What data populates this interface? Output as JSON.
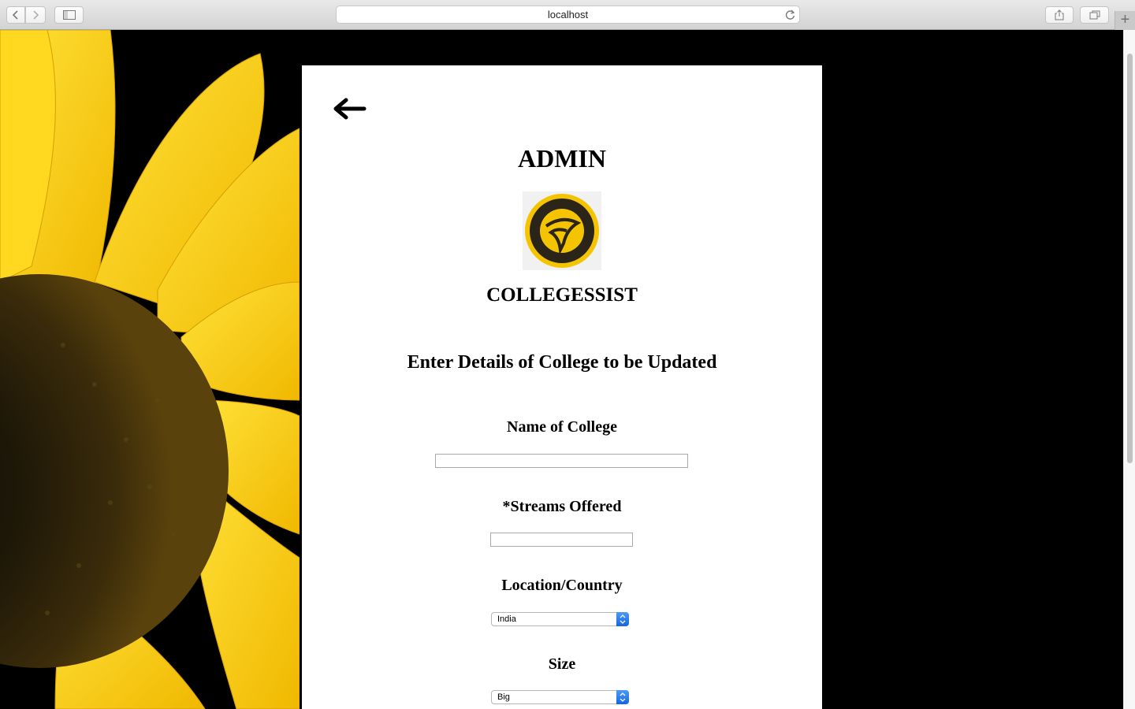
{
  "browser": {
    "address": "localhost"
  },
  "page": {
    "role_title": "ADMIN",
    "brand_name": "COLLEGESSIST",
    "form_heading": "Enter Details of College to be Updated",
    "fields": {
      "college_name": {
        "label": "Name of College",
        "value": ""
      },
      "streams": {
        "label": "*Streams Offered",
        "value": ""
      },
      "location": {
        "label": "Location/Country",
        "selected": "India"
      },
      "size": {
        "label": "Size",
        "selected": "Big"
      }
    }
  },
  "colors": {
    "logo_yellow": "#f5c400",
    "logo_dark": "#2a2419",
    "select_accent": "#1e6fe8"
  },
  "icons": [
    "back-arrow-icon",
    "reload-icon",
    "share-icon",
    "tabs-icon",
    "sidebar-icon",
    "chevron-left-icon",
    "chevron-right-icon"
  ]
}
